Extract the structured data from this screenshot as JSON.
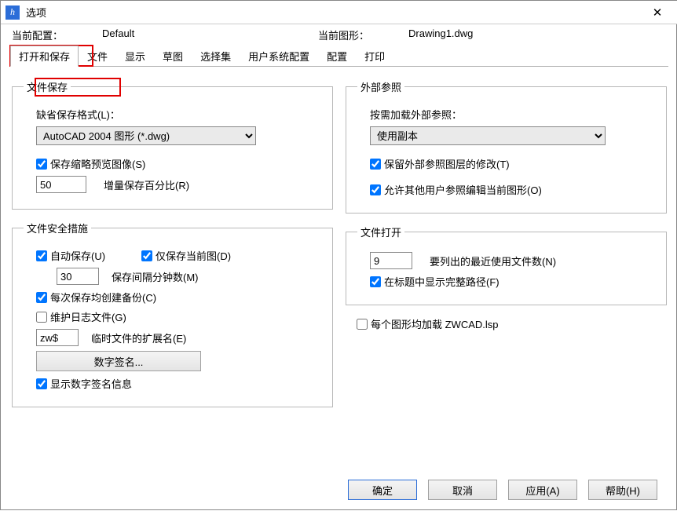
{
  "window": {
    "title": "选项"
  },
  "info": {
    "currentProfileLabel": "当前配置：",
    "currentProfileValue": "Default",
    "currentDrawingLabel": "当前图形：",
    "currentDrawingValue": "Drawing1.dwg"
  },
  "tabs": {
    "t0": "打开和保存",
    "t1": "文件",
    "t2": "显示",
    "t3": "草图",
    "t4": "选择集",
    "t5": "用户系统配置",
    "t6": "配置",
    "t7": "打印"
  },
  "fileSave": {
    "legend": "文件保存",
    "defaultFormatLabel": "缺省保存格式(L)：",
    "defaultFormatValue": "AutoCAD 2004 图形 (*.dwg)",
    "maintainPreview": "保存缩略预览图像(S)",
    "incPercentValue": "50",
    "incPercentLabel": "增量保存百分比(R)"
  },
  "safety": {
    "legend": "文件安全措施",
    "autosave": "自动保存(U)",
    "saveCurrentOnly": "仅保存当前图(D)",
    "intervalValue": "30",
    "intervalLabel": "保存间隔分钟数(M)",
    "backup": "每次保存均创建备份(C)",
    "log": "维护日志文件(G)",
    "extValue": "zw$",
    "extLabel": "临时文件的扩展名(E)",
    "digSigBtn": "数字签名...",
    "showDigSig": "显示数字签名信息"
  },
  "xref": {
    "legend": "外部参照",
    "demandLoadLabel": "按需加载外部参照：",
    "demandLoadValue": "使用副本",
    "retainChanges": "保留外部参照图层的修改(T)",
    "allowOthers": "允许其他用户参照编辑当前图形(O)"
  },
  "fileOpen": {
    "legend": "文件打开",
    "recentCountValue": "9",
    "recentCountLabel": "要列出的最近使用文件数(N)",
    "showFullPath": "在标题中显示完整路径(F)"
  },
  "misc": {
    "loadLsp": "每个图形均加载 ZWCAD.lsp"
  },
  "footer": {
    "ok": "确定",
    "cancel": "取消",
    "apply": "应用(A)",
    "help": "帮助(H)"
  }
}
